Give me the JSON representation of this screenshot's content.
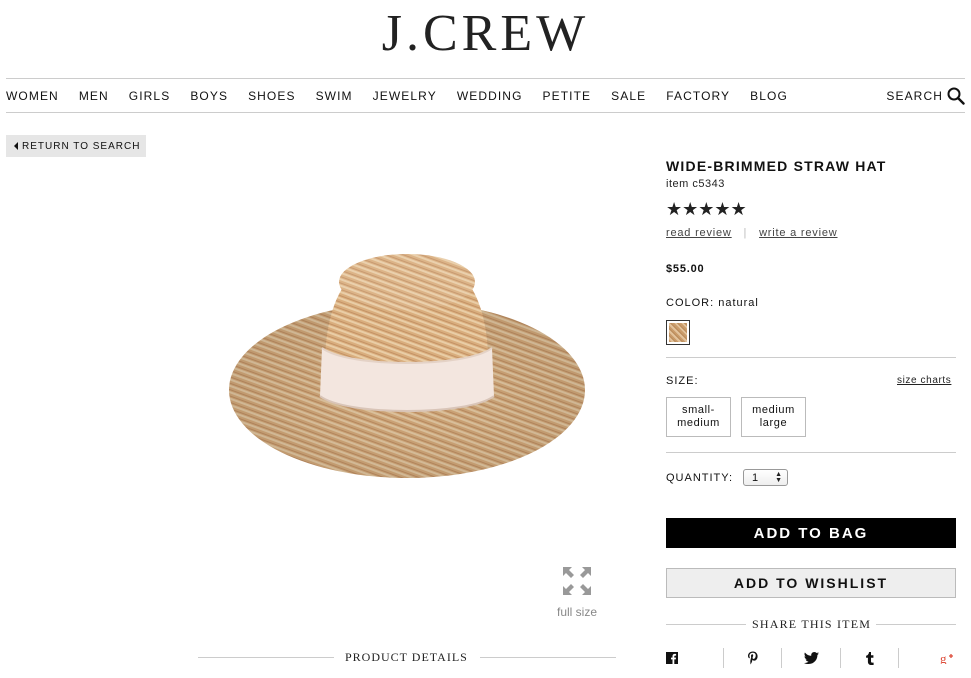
{
  "brand": {
    "logo": "J.CREW"
  },
  "nav": {
    "items": [
      "WOMEN",
      "MEN",
      "GIRLS",
      "BOYS",
      "SHOES",
      "SWIM",
      "JEWELRY",
      "WEDDING",
      "PETITE",
      "SALE",
      "FACTORY",
      "BLOG"
    ],
    "search_label": "SEARCH"
  },
  "return_label": "RETURN TO SEARCH",
  "product": {
    "title": "WIDE-BRIMMED STRAW HAT",
    "item_number": "item c5343",
    "rating_stars": "★★★★★",
    "rating": 5,
    "read_review": "read review",
    "separator": "|",
    "write_review": "write a review",
    "price": "$55.00",
    "color_label": "COLOR: natural",
    "size_label": "SIZE:",
    "size_charts": "size charts",
    "sizes": [
      {
        "line1": "small-",
        "line2": "medium"
      },
      {
        "line1": "medium",
        "line2": "large"
      }
    ],
    "quantity_label": "QUANTITY:",
    "quantity_value": "1",
    "add_to_bag": "ADD TO BAG",
    "add_to_wishlist": "ADD TO WISHLIST",
    "share_title": "SHARE THIS ITEM",
    "social_icons": [
      "facebook-icon",
      "pinterest-icon",
      "twitter-icon",
      "tumblr-icon",
      "google-plus-icon"
    ]
  },
  "image": {
    "full_size_label": "full size"
  },
  "details": {
    "title": "PRODUCT DETAILS"
  },
  "colors": {
    "primary_button": "#000000",
    "secondary_button": "#eeeeee",
    "google_plus": "#dd4b39"
  }
}
